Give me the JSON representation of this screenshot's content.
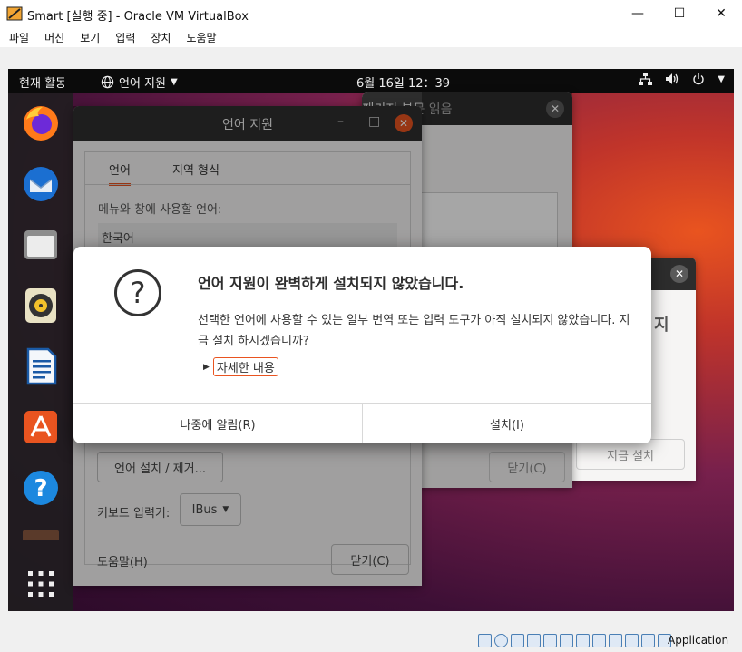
{
  "host": {
    "title": "Smart [실행 중] - Oracle VM VirtualBox",
    "menus": [
      "파일",
      "머신",
      "보기",
      "입력",
      "장치",
      "도움말"
    ],
    "controls": {
      "minimize": "—",
      "maximize": "☐",
      "close": "✕"
    },
    "status_host_key": "Application"
  },
  "topbar": {
    "activities": "현재 활동",
    "language_menu": "언어 지원",
    "clock": "6월 16일  12：39"
  },
  "bg_window_front": {
    "title": "언어 지원",
    "tabs": [
      "언어",
      "지역 형식"
    ],
    "menu_lang_label": "메뉴와 창에 사용할 언어:",
    "selected_language": "한국어",
    "install_remove_button": "언어 설치 / 제거...",
    "keyboard_label": "키보드 입력기:",
    "keyboard_value": "IBus",
    "help_button": "도움말(H)",
    "close_button": "닫기(C)"
  },
  "bg_window_mid": {
    "title": "패키지 본문 읽음",
    "close_button": "닫기(C)"
  },
  "bg_window_right": {
    "partial_text": "지",
    "install_now_button": "지금 설치"
  },
  "dialog": {
    "title": "언어 지원이 완벽하게 설치되지 않았습니다.",
    "message": "선택한 언어에 사용할 수 있는 일부 번역 또는 입력 도구가 아직 설치되지 않았습니다. 지금 설치 하시겠습니까?",
    "details": "자세한 내용",
    "remind_later": "나중에 알림(R)",
    "install": "설치(I)"
  },
  "colors": {
    "ubuntu_orange": "#e95420",
    "topbar": "#0b0b0b",
    "dialog_bg": "#ffffff"
  }
}
